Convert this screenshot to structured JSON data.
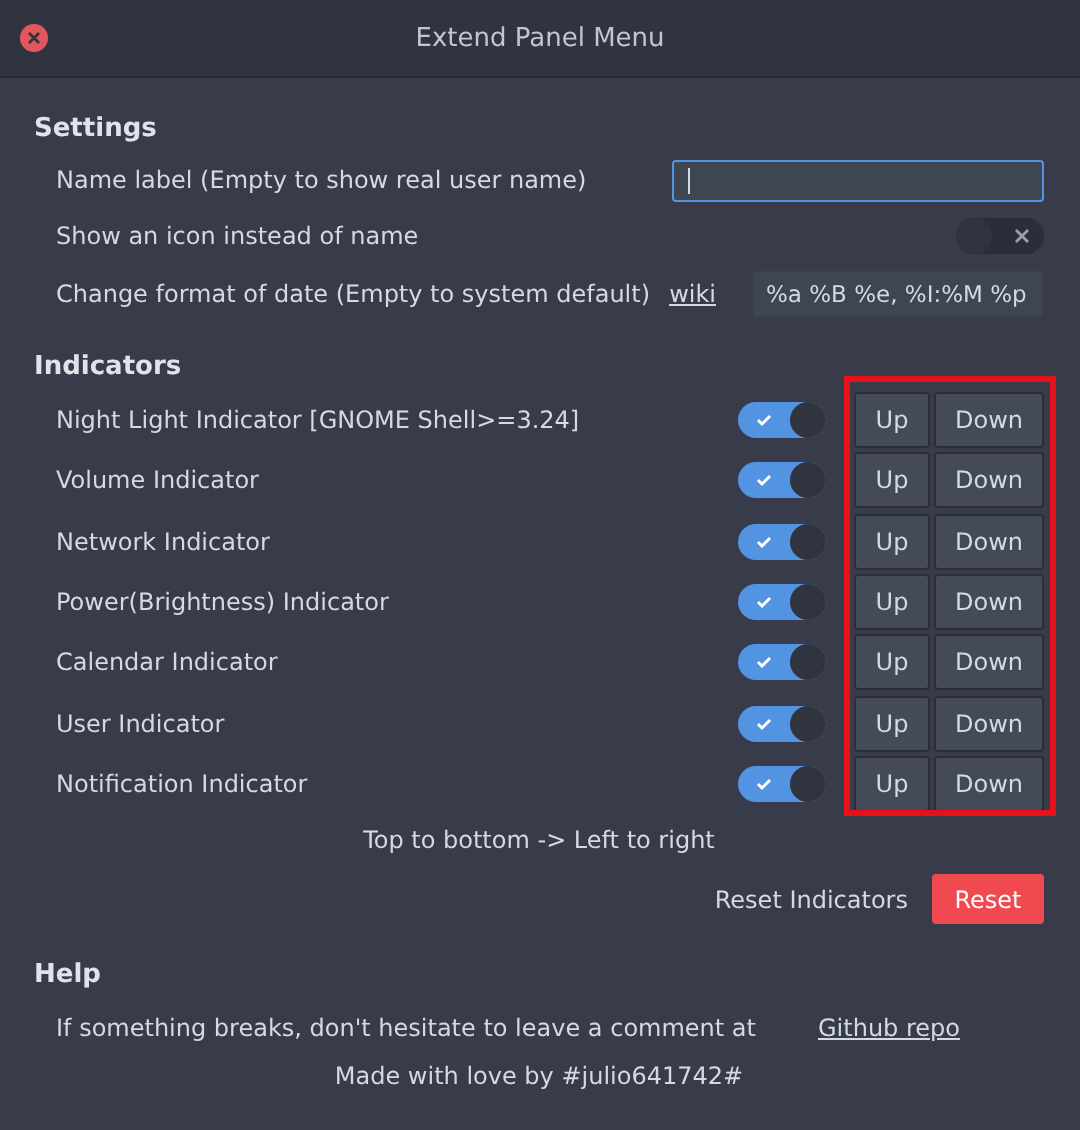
{
  "window": {
    "title": "Extend Panel Menu"
  },
  "settings": {
    "heading": "Settings",
    "rows": [
      {
        "kind": "field",
        "label": "Name label (Empty to show real user name)",
        "focused": true
      },
      {
        "kind": "switch",
        "label": "Show an icon instead of name",
        "on": false
      },
      {
        "kind": "format",
        "label": "Change format of date (Empty to system default)",
        "link": "wiki",
        "value": "%a %B %e, %I:%M %p"
      }
    ]
  },
  "indicators": {
    "heading": "Indicators",
    "items": [
      {
        "label": "Night Light Indicator [GNOME Shell>=3.24]",
        "on": true,
        "up": "Up",
        "down": "Down"
      },
      {
        "label": "Volume Indicator",
        "on": true,
        "up": "Up",
        "down": "Down"
      },
      {
        "label": "Network Indicator",
        "on": true,
        "up": "Up",
        "down": "Down"
      },
      {
        "label": "Power(Brightness) Indicator",
        "on": true,
        "up": "Up",
        "down": "Down"
      },
      {
        "label": "Calendar Indicator",
        "on": true,
        "up": "Up",
        "down": "Down"
      },
      {
        "label": "User Indicator",
        "on": true,
        "up": "Up",
        "down": "Down"
      },
      {
        "label": "Notification Indicator",
        "on": true,
        "up": "Up",
        "down": "Down"
      }
    ],
    "note": "Top to bottom -> Left to right",
    "reset_label": "Reset Indicators",
    "reset_button": "Reset"
  },
  "help": {
    "heading": "Help",
    "text": "If something breaks, don't hesitate to leave a comment at",
    "link": "Github repo",
    "credit": "Made with love by #julio641742#"
  }
}
